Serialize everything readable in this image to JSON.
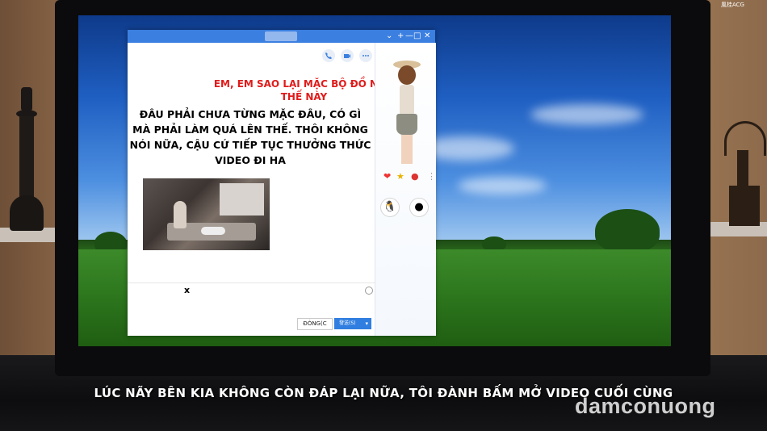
{
  "chat": {
    "red_message": "EM, EM SAO LẠI MẶC BỘ ĐỒ NHƯ THẾ NÀY",
    "black_message": "ĐÂU PHẢI CHƯA TỪNG MẶC ĐÂU, CÓ GÌ MÀ PHẢI LÀM QUÁ LÊN THẾ. THÔI KHÔNG NÓI NỮA, CẬU CỨ TIẾP TỤC THƯỞNG THỨC VIDEO ĐI HA",
    "input_value": "x",
    "close_label": "ĐÓNG(C",
    "send_label": "發送(S)",
    "send_caret": "▾",
    "window_controls": [
      "⌄",
      "+",
      "—",
      "□",
      "✕"
    ]
  },
  "caption": "LÚC NÃY BÊN KIA KHÔNG CÒN ĐÁP LẠI NỮA, TÔI ĐÀNH BẤM MỞ VIDEO CUỐI CÙNG",
  "watermark": "damconuong",
  "logo": "風桂ACG",
  "icons": {
    "phone": "phone-icon",
    "video": "video-camera-icon",
    "more": "more-icon"
  },
  "colors": {
    "titlebar": "#3b7fe0",
    "red_text": "#e11b1b",
    "send_button": "#2f7ee0"
  }
}
